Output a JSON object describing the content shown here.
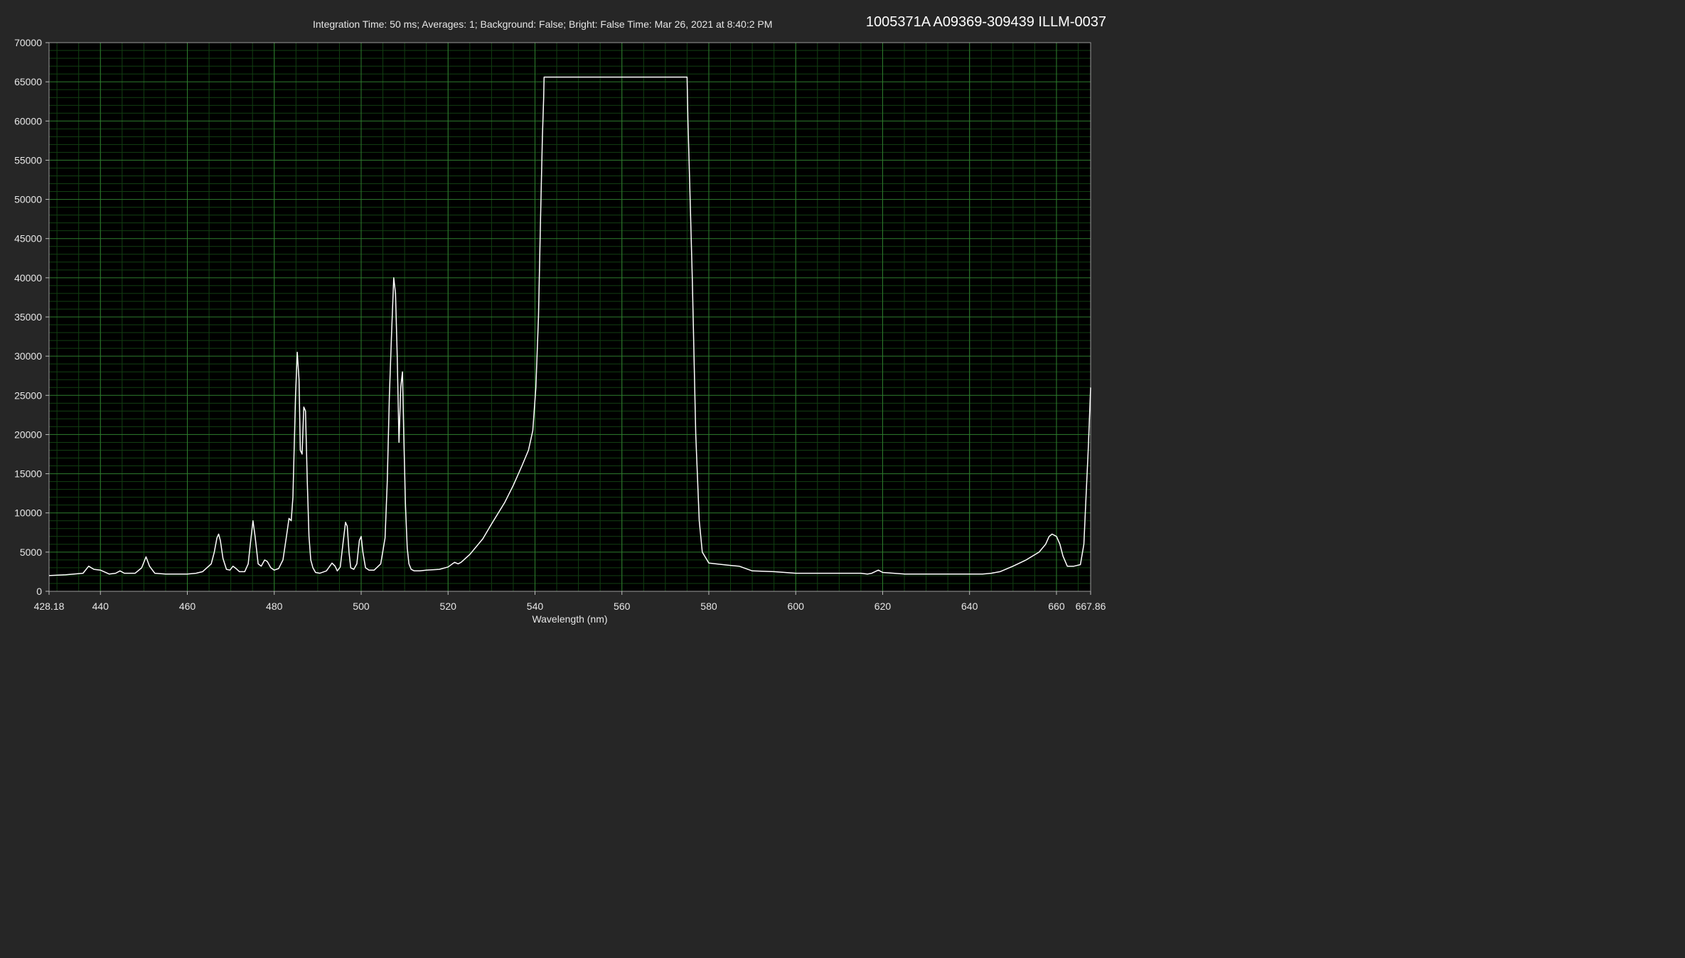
{
  "header": {
    "info": "Integration Time: 50 ms; Averages: 1; Background: False; Bright: False Time: Mar 26, 2021 at 8:40:2 PM",
    "instrument_id": "1005371A A09369-309439 ILLM-0037"
  },
  "colors": {
    "background": "#262626",
    "plot_background": "#000000",
    "grid_major": "#2e7d2e",
    "grid_minor": "#123f12",
    "trace": "#ffffff"
  },
  "chart_data": {
    "type": "line",
    "title": "",
    "xlabel": "Wavelength (nm)",
    "ylabel": "",
    "xlim": [
      428.18,
      667.86
    ],
    "ylim": [
      0,
      70000
    ],
    "grid": true,
    "x_ticks": [
      "428.18",
      "440",
      "460",
      "480",
      "500",
      "520",
      "540",
      "560",
      "580",
      "600",
      "620",
      "640",
      "660",
      "667.86"
    ],
    "x_tick_values": [
      428.18,
      440,
      460,
      480,
      500,
      520,
      540,
      560,
      580,
      600,
      620,
      640,
      660,
      667.86
    ],
    "y_ticks": [
      "0",
      "5000",
      "10000",
      "15000",
      "20000",
      "25000",
      "30000",
      "35000",
      "40000",
      "45000",
      "50000",
      "55000",
      "60000",
      "65000",
      "70000"
    ],
    "y_tick_values": [
      0,
      5000,
      10000,
      15000,
      20000,
      25000,
      30000,
      35000,
      40000,
      45000,
      50000,
      55000,
      60000,
      65000,
      70000
    ],
    "series": [
      {
        "x": [
          428.18,
          432,
          436,
          437.3,
          438.5,
          440,
          442,
          443.5,
          444.5,
          445.5,
          448,
          449.5,
          450.5,
          451.3,
          452.5,
          455,
          460,
          462,
          463.5,
          464.5,
          465.5,
          466.2,
          466.8,
          467.2,
          467.6,
          468.2,
          469,
          469.8,
          470.5,
          471.2,
          472,
          473.2,
          474,
          474.6,
          475.1,
          475.6,
          476.3,
          477,
          477.8,
          478.4,
          479.2,
          480,
          481,
          482,
          482.8,
          483.4,
          483.9,
          484.3,
          484.9,
          485.3,
          485.7,
          486,
          486.4,
          486.8,
          487.2,
          487.6,
          488,
          488.4,
          488.9,
          489.5,
          490.5,
          492,
          493.3,
          494,
          494.5,
          495.2,
          495.8,
          496.4,
          496.8,
          497.2,
          497.6,
          498.3,
          499,
          499.6,
          500,
          500.4,
          501,
          501.8,
          503,
          504.5,
          505.5,
          506,
          506.5,
          507,
          507.5,
          507.9,
          508.3,
          508.7,
          509.1,
          509.5,
          509.8,
          510.2,
          510.6,
          511,
          511.5,
          512.2,
          513.5,
          515,
          518,
          520,
          521.5,
          522.3,
          523,
          525,
          528,
          530,
          533,
          535,
          537,
          538.5,
          539.5,
          540.2,
          540.8,
          541.3,
          541.7,
          542,
          542.1,
          575,
          575.2,
          575.6,
          576.2,
          577,
          577.8,
          578.5,
          580,
          585,
          587,
          588,
          590,
          595,
          600,
          605,
          610,
          615,
          616.5,
          617.5,
          619,
          620,
          625,
          630,
          635,
          640,
          643,
          645,
          647,
          650,
          653,
          656,
          657.5,
          658.3,
          659,
          660,
          660.8,
          661.5,
          662.5,
          664,
          665.5,
          666.3,
          666.8,
          667.3,
          667.86
        ],
        "values": [
          2000,
          2100,
          2300,
          3200,
          2800,
          2700,
          2200,
          2300,
          2600,
          2300,
          2300,
          3000,
          4400,
          3200,
          2300,
          2200,
          2200,
          2300,
          2500,
          3000,
          3500,
          5000,
          6800,
          7300,
          6500,
          4200,
          2800,
          2700,
          3200,
          2900,
          2500,
          2500,
          3500,
          6500,
          9000,
          7000,
          3500,
          3200,
          4000,
          3800,
          3000,
          2700,
          2900,
          4000,
          7000,
          9300,
          9000,
          12000,
          25000,
          30500,
          27000,
          18000,
          17500,
          23500,
          23000,
          14000,
          7000,
          4000,
          3000,
          2400,
          2300,
          2600,
          3600,
          3200,
          2600,
          3100,
          6000,
          8800,
          8300,
          5000,
          3000,
          2800,
          3500,
          6500,
          7000,
          5000,
          3000,
          2700,
          2700,
          3500,
          6800,
          14000,
          25000,
          33000,
          40000,
          38000,
          30000,
          19000,
          26000,
          28000,
          20000,
          11000,
          5500,
          3500,
          2800,
          2600,
          2600,
          2700,
          2800,
          3100,
          3700,
          3500,
          3700,
          4700,
          6700,
          8600,
          11300,
          13500,
          16000,
          18000,
          20500,
          26000,
          35000,
          48000,
          58000,
          63000,
          65600,
          65600,
          60000,
          52000,
          40000,
          20000,
          9000,
          5000,
          3600,
          3300,
          3200,
          3000,
          2600,
          2500,
          2300,
          2300,
          2300,
          2300,
          2200,
          2300,
          2700,
          2400,
          2200,
          2200,
          2200,
          2200,
          2200,
          2300,
          2500,
          3200,
          4000,
          5000,
          6000,
          7000,
          7300,
          7000,
          6000,
          4500,
          3200,
          3200,
          3400,
          6000,
          12000,
          18000,
          26000
        ]
      }
    ]
  }
}
